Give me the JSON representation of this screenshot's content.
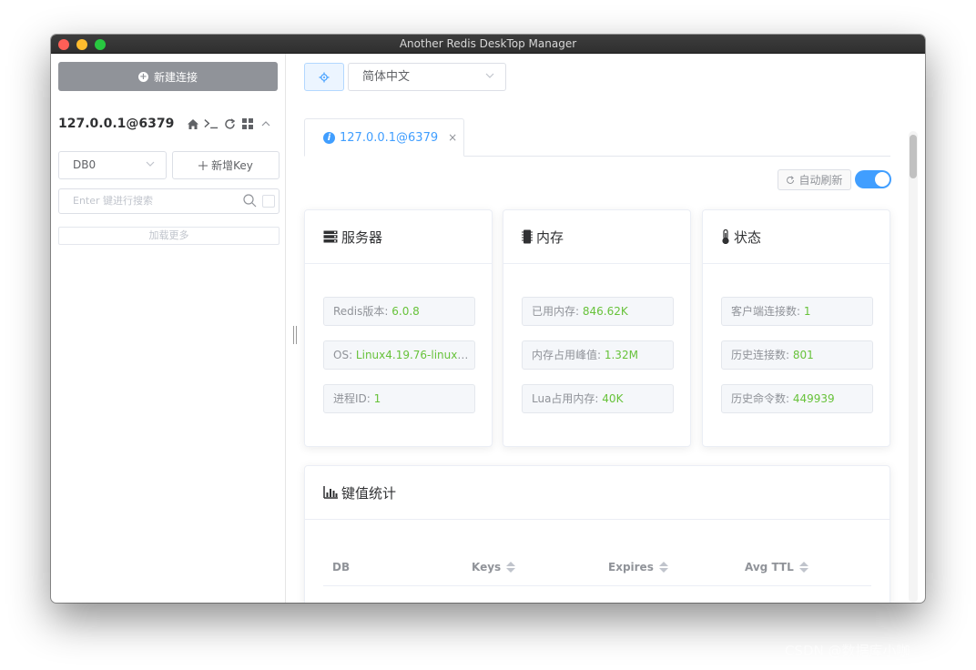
{
  "window": {
    "title": "Another Redis DeskTop Manager"
  },
  "sidebar": {
    "new_connection_label": "新建连接",
    "connection_name": "127.0.0.1@6379",
    "db_select": "DB0",
    "add_key_label": "新增Key",
    "search_placeholder": "Enter 键进行搜索",
    "load_more_label": "加载更多"
  },
  "toolbar": {
    "language": "简体中文"
  },
  "tab": {
    "label": "127.0.0.1@6379"
  },
  "auto_refresh": {
    "label": "自动刷新",
    "enabled": true
  },
  "cards": {
    "server": {
      "title": "服务器",
      "stats": [
        {
          "label": "Redis版本: ",
          "value": "6.0.8"
        },
        {
          "label": "OS: ",
          "value": "Linux4.19.76-linuxkit..."
        },
        {
          "label": "进程ID: ",
          "value": "1"
        }
      ]
    },
    "memory": {
      "title": "内存",
      "stats": [
        {
          "label": "已用内存: ",
          "value": "846.62K"
        },
        {
          "label": "内存占用峰值: ",
          "value": "1.32M"
        },
        {
          "label": "Lua占用内存: ",
          "value": "40K"
        }
      ]
    },
    "status": {
      "title": "状态",
      "stats": [
        {
          "label": "客户端连接数: ",
          "value": "1"
        },
        {
          "label": "历史连接数: ",
          "value": "801"
        },
        {
          "label": "历史命令数: ",
          "value": "449939"
        }
      ]
    },
    "keyspace": {
      "title": "键值统计",
      "columns": [
        "DB",
        "Keys",
        "Expires",
        "Avg TTL"
      ]
    }
  },
  "colors": {
    "primary": "#409eff",
    "value_green": "#67c23a",
    "new_conn_bg": "#909399"
  },
  "watermark": "CSDN @数据库小咖"
}
